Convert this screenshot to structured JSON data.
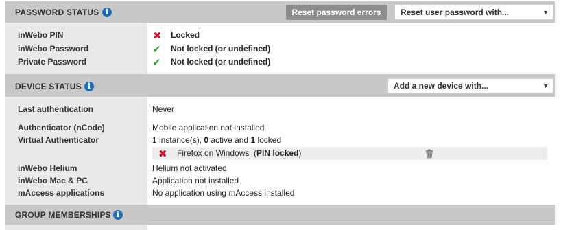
{
  "password_status": {
    "title": "PASSWORD STATUS",
    "reset_errors_button": "Reset password errors",
    "reset_select": "Reset user password with...",
    "rows": [
      {
        "label": "inWebo PIN",
        "status": "Locked",
        "state": "locked"
      },
      {
        "label": "inWebo Password",
        "status": "Not locked (or undefined)",
        "state": "ok"
      },
      {
        "label": "Private Password",
        "status": "Not locked (or undefined)",
        "state": "ok"
      }
    ]
  },
  "device_status": {
    "title": "DEVICE STATUS",
    "add_select": "Add a new device with...",
    "last_auth_label": "Last authentication",
    "last_auth_value": "Never",
    "authenticator_label": "Authenticator (nCode)",
    "authenticator_value": "Mobile application not installed",
    "virtual_label": "Virtual Authenticator",
    "virtual_parts": {
      "count_prefix": "1 instance(s), ",
      "active": "0",
      "mid": " active and ",
      "locked": "1",
      "suffix": " locked"
    },
    "device_entry": {
      "name": "Firefox on Windows",
      "open_paren": "(",
      "status": "PIN locked",
      "close_paren": ")"
    },
    "helium_label": "inWebo Helium",
    "helium_value": "Helium not activated",
    "macpc_label": "inWebo Mac & PC",
    "macpc_value": "Application not installed",
    "maccess_label": "mAccess applications",
    "maccess_value": "No application using mAccess installed"
  },
  "group_memberships": {
    "title": "GROUP MEMBERSHIPS"
  },
  "icons": {
    "info": "i",
    "cross": "✖",
    "check": "✔",
    "dropdown": "▼",
    "trash": "trash-icon"
  },
  "colors": {
    "header_bg": "#c8c8c8",
    "label_col_bg": "#e9e9e9",
    "info_blue": "#1f6db4",
    "error_red": "#c8142b",
    "ok_green": "#3a9a34",
    "button_gray": "#8c8c8c"
  }
}
